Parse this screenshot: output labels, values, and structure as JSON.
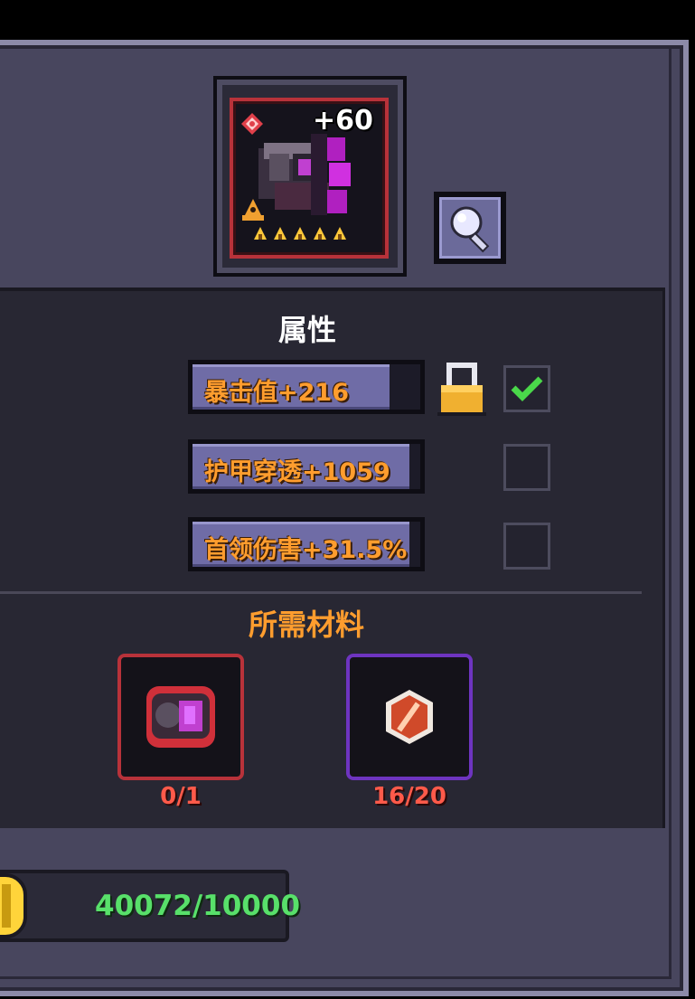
{
  "item": {
    "level_label": "+60",
    "star_count": 5,
    "icons": [
      "rarity-diamond-icon",
      "class-hat-icon",
      "star-icon",
      "weapon-art"
    ]
  },
  "magnifier": {
    "icon": "magnifier-icon"
  },
  "attributes": {
    "title": "属性",
    "stats": [
      {
        "label": "暴击值+216",
        "locked": true,
        "checked": true
      },
      {
        "label": "护甲穿透+1059",
        "locked": false,
        "checked": false
      },
      {
        "label": "首领伤害+31.5%",
        "locked": false,
        "checked": false
      }
    ]
  },
  "materials": {
    "title": "所需材料",
    "slots": [
      {
        "icon": "weapon-fragment-icon",
        "count": "0/1",
        "rarity_color": "#b8323a"
      },
      {
        "icon": "forge-stone-icon",
        "count": "16/20",
        "rarity_color": "#6e34c0"
      }
    ]
  },
  "gold": {
    "icon": "gold-coin-icon",
    "amount": "40072/10000"
  },
  "colors": {
    "panel": "#48465e",
    "stat_text": "#ff9d2e",
    "count_text": "#ff5a4a",
    "gold_text": "#58e06a"
  }
}
